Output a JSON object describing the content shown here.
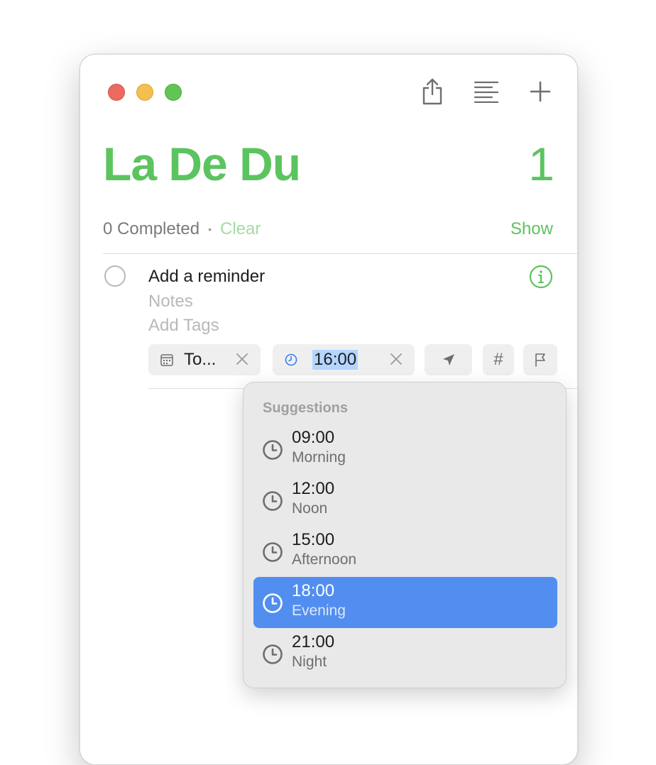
{
  "window": {
    "toolbar": {
      "share_icon": "share-icon",
      "list_icon": "list-view-icon",
      "add_icon": "plus-icon"
    }
  },
  "list": {
    "title": "La De Du",
    "count": "1",
    "accent_color": "#5cc45f",
    "completed_text": "0 Completed",
    "separator": "•",
    "clear_label": "Clear",
    "show_label": "Show"
  },
  "reminder": {
    "title": "Add a reminder",
    "notes_placeholder": "Notes",
    "tags_placeholder": "Add Tags",
    "date_chip": "To...",
    "time_chip": "16:00",
    "tag_chip": "#"
  },
  "suggestions": {
    "header": "Suggestions",
    "items": [
      {
        "time": "09:00",
        "label": "Morning"
      },
      {
        "time": "12:00",
        "label": "Noon"
      },
      {
        "time": "15:00",
        "label": "Afternoon"
      },
      {
        "time": "18:00",
        "label": "Evening"
      },
      {
        "time": "21:00",
        "label": "Night"
      }
    ],
    "selected_index": 3,
    "selected_color": "#528ef0"
  }
}
